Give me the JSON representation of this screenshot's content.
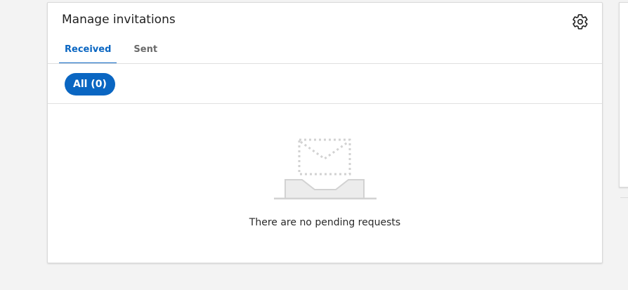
{
  "card": {
    "title": "Manage invitations",
    "settings_icon": "gear-icon"
  },
  "tabs": [
    {
      "label": "Received",
      "active": true
    },
    {
      "label": "Sent",
      "active": false
    }
  ],
  "filter": {
    "label": "All (0)"
  },
  "empty_state": {
    "illustration_icon": "empty-envelope-icon",
    "message": "There are no pending requests"
  },
  "colors": {
    "accent": "#0a66c2",
    "background": "#f3f3f3"
  }
}
